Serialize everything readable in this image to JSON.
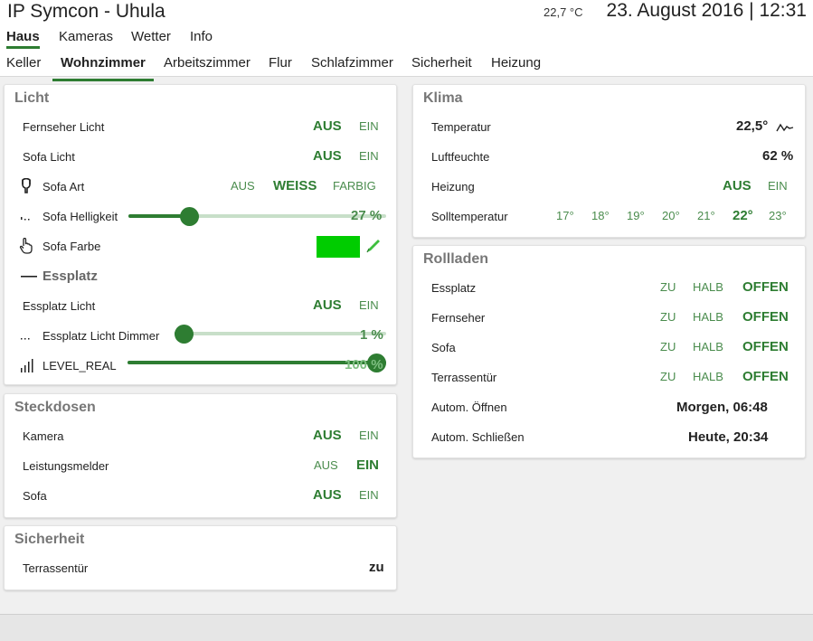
{
  "header": {
    "app_title": "IP Symcon - Uhula",
    "temperature": "22,7 °C",
    "datetime": "23. August 2016 | 12:31"
  },
  "nav_main": [
    "Haus",
    "Kameras",
    "Wetter",
    "Info"
  ],
  "nav_rooms": [
    "Keller",
    "Wohnzimmer",
    "Arbeitszimmer",
    "Flur",
    "Schlafzimmer",
    "Sicherheit",
    "Heizung"
  ],
  "colors": {
    "accent": "#2e7d32",
    "accent_light": "#4a8c4d",
    "color_swatch": "#00cc00"
  },
  "licht": {
    "title": "Licht",
    "fernseher_licht": {
      "label": "Fernseher Licht",
      "aus": "AUS",
      "ein": "EIN"
    },
    "sofa_licht": {
      "label": "Sofa Licht",
      "aus": "AUS",
      "ein": "EIN"
    },
    "sofa_art": {
      "label": "Sofa Art",
      "aus": "AUS",
      "weiss": "WEISS",
      "farbig": "FARBIG",
      "icon": "bulb-icon"
    },
    "sofa_helligkeit": {
      "label": "Sofa Helligkeit",
      "percent_text": "27 %",
      "value": 27,
      "icon": "dots-icon"
    },
    "sofa_farbe": {
      "label": "Sofa Farbe",
      "icon": "hand-pointer-icon",
      "edit_icon": "pencil-icon"
    },
    "essplatz": {
      "label": "Essplatz",
      "icon": "dash-icon"
    },
    "essplatz_licht": {
      "label": "Essplatz Licht",
      "aus": "AUS",
      "ein": "EIN"
    },
    "essplatz_dimmer": {
      "label": "Essplatz Licht Dimmer",
      "percent_text": "1 %",
      "value": 1,
      "icon": "dots-icon"
    },
    "level_real": {
      "label": "LEVEL_REAL",
      "percent_text": "100 %",
      "value": 100,
      "icon": "signal-bars-icon"
    }
  },
  "steckdosen": {
    "title": "Steckdosen",
    "kamera": {
      "label": "Kamera",
      "aus": "AUS",
      "ein": "EIN"
    },
    "leistungsmelder": {
      "label": "Leistungsmelder",
      "aus": "AUS",
      "ein": "EIN"
    },
    "sofa": {
      "label": "Sofa",
      "aus": "AUS",
      "ein": "EIN"
    }
  },
  "sicherheit": {
    "title": "Sicherheit",
    "terrassentuer": {
      "label": "Terrassentür",
      "value": "zu"
    }
  },
  "klima": {
    "title": "Klima",
    "temperatur": {
      "label": "Temperatur",
      "value": "22,5°",
      "icon": "chart-line-icon"
    },
    "luftfeuchte": {
      "label": "Luftfeuchte",
      "value": "62 %"
    },
    "heizung": {
      "label": "Heizung",
      "aus": "AUS",
      "ein": "EIN"
    },
    "solltemperatur": {
      "label": "Solltemperatur",
      "options": [
        "17°",
        "18°",
        "19°",
        "20°",
        "21°",
        "22°",
        "23°"
      ],
      "selected": "22°"
    }
  },
  "rollladen": {
    "title": "Rollladen",
    "items": [
      {
        "label": "Essplatz",
        "zu": "ZU",
        "halb": "HALB",
        "offen": "OFFEN"
      },
      {
        "label": "Fernseher",
        "zu": "ZU",
        "halb": "HALB",
        "offen": "OFFEN"
      },
      {
        "label": "Sofa",
        "zu": "ZU",
        "halb": "HALB",
        "offen": "OFFEN"
      },
      {
        "label": "Terrassentür",
        "zu": "ZU",
        "halb": "HALB",
        "offen": "OFFEN"
      }
    ],
    "autom_oeffnen": {
      "label": "Autom. Öffnen",
      "value": "Morgen, 06:48"
    },
    "autom_schliessen": {
      "label": "Autom. Schließen",
      "value": "Heute, 20:34"
    }
  }
}
